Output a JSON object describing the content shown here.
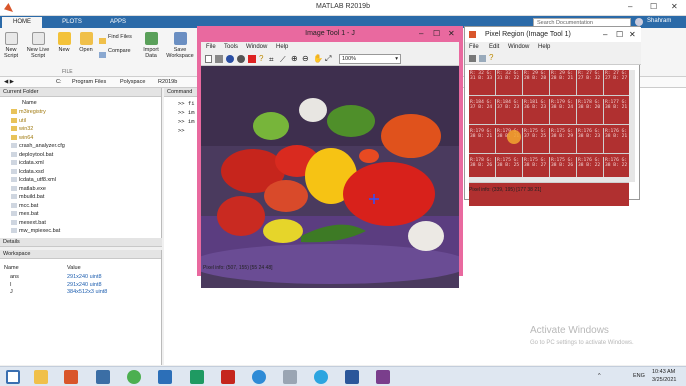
{
  "matlab": {
    "title": "MATLAB R2019b",
    "window_controls": [
      "–",
      "☐",
      "✕"
    ],
    "search_placeholder": "Search Documentation",
    "user": "Shahram",
    "tabs": [
      "HOME",
      "PLOTS",
      "APPS"
    ],
    "ribbon_buttons": [
      {
        "label": "New Script"
      },
      {
        "label": "New Live Script"
      },
      {
        "label": "New"
      },
      {
        "label": "Open"
      },
      {
        "label": "Find Files"
      },
      {
        "label": "Compare"
      },
      {
        "label": "Import Data"
      },
      {
        "label": "Save Workspace"
      }
    ],
    "ribbon_group": "FILE",
    "address_crumbs": [
      "C:",
      "Program Files",
      "Polyspace",
      "R2019b"
    ],
    "current_folder": {
      "title": "Current Folder",
      "column": "Name",
      "items": [
        "m3iregistry",
        "util",
        "win32",
        "win64",
        "crash_analyzer.cfg",
        "deploytool.bat",
        "icdata.xml",
        "lcdata.xsd",
        "lcdata_utf8.xml",
        "matlab.exe",
        "mbuild.bat",
        "mcc.bat",
        "mex.bat",
        "mexext.bat",
        "mw_mpiexec.bat"
      ]
    },
    "details_label": "Details",
    "workspace": {
      "title": "Workspace",
      "columns": [
        "Name",
        "Value"
      ],
      "rows": [
        {
          "name": "ans",
          "value": "291x240 uint8"
        },
        {
          "name": "I",
          "value": "291x240 uint8"
        },
        {
          "name": "J",
          "value": "384x512x3 uint8"
        }
      ]
    },
    "command_window": {
      "title": "Command",
      "lines": [
        ">> fi",
        ">> im",
        ">> im",
        ">>"
      ]
    }
  },
  "image_tool": {
    "title": "Image Tool 1 - J",
    "menu": [
      "File",
      "Tools",
      "Window",
      "Help"
    ],
    "zoom": "100%",
    "pixel_info": "Pixel info: (507, 155)  [55 24 48]"
  },
  "pixel_region": {
    "title": "Pixel Region (Image Tool 1)",
    "menu": [
      "File",
      "Edit",
      "Window",
      "Help"
    ],
    "pixel_info": "Pixel info: (339, 195)  [177 38 21]",
    "cells": [
      [
        "R: 32 G: 31 B: 33",
        "R: 32 G: 31 B: 22",
        "R: 29 G: 28 B: 28",
        "R: 29 G: 28 B: 21",
        "R: 27 G: 27 B: 32",
        "R: 27 G: 27 B: 27"
      ],
      [
        "R:184 G: 37 B: 24",
        "R:184 G: 37 B: 23",
        "R:181 G: 36 B: 23",
        "R:179 G: 38 B: 24",
        "R:178 G: 38 B: 20",
        "R:177 G: 38 B: 21"
      ],
      [
        "R:179 G: 38 B: 21",
        "R:179 G: 38 B: 21",
        "R:175 G: 37 B: 25",
        "R:175 G: 38 B: 29",
        "R:176 G: 38 B: 23",
        "R:176 G: 38 B: 21"
      ],
      [
        "R:178 G: 38 B: 26",
        "R:175 G: 38 B: 25",
        "R:175 G: 38 B: 27",
        "R:175 G: 38 B: 26",
        "R:176 G: 38 B: 22",
        "R:176 G: 38 B: 22"
      ]
    ]
  },
  "watermark": {
    "title": "Activate Windows",
    "subtitle": "Go to PC settings to activate Windows."
  },
  "taskbar": {
    "language": "ENG",
    "time": "10:43 AM",
    "date": "3/25/2021"
  },
  "colors": {
    "ribbon_blue": "#2b6aa8",
    "image_tool_frame": "#e9699f",
    "pixel_region_red": "#b03030"
  }
}
